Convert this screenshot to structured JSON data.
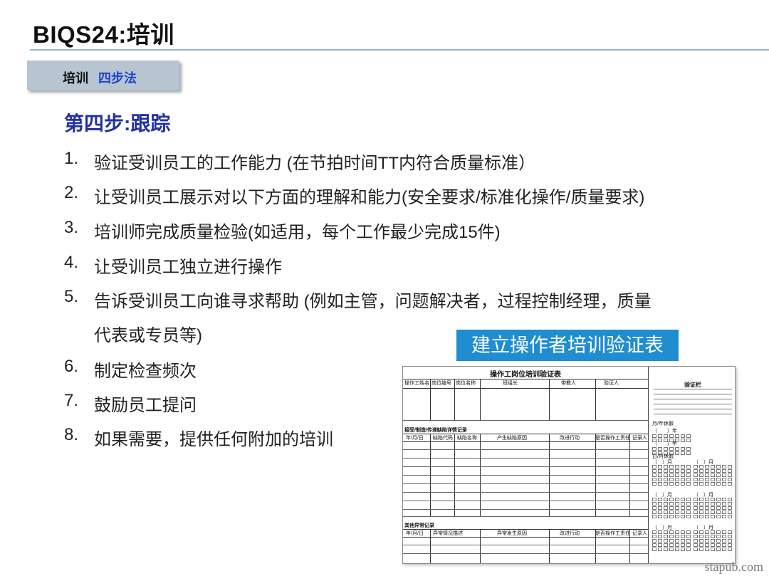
{
  "header": {
    "title": "BIQS24:培训"
  },
  "tab": {
    "part1": "培训",
    "part2": "四步法"
  },
  "step_title": "第四步:跟踪",
  "items": [
    {
      "num": "1.",
      "text": "验证受训员工的工作能力 (在节拍时间TT内符合质量标准）"
    },
    {
      "num": "2.",
      "text": "让受训员工展示对以下方面的理解和能力(安全要求/标准化操作/质量要求)"
    },
    {
      "num": "3.",
      "text": "培训师完成质量检验(如适用，每个工作最少完成15件)"
    },
    {
      "num": "4.",
      "text": "让受训员工独立进行操作"
    },
    {
      "num": "5.",
      "text": "告诉受训员工向谁寻求帮助 (例如主管，问题解决者，过程控制经理，质量",
      "text2": "代表或专员等)"
    },
    {
      "num": "6.",
      "text": "制定检查频次"
    },
    {
      "num": "7.",
      "text": "鼓励员工提问"
    },
    {
      "num": "8.",
      "text": "如果需要，提供任何附加的培训"
    }
  ],
  "banner": "建立操作者培训验证表",
  "form": {
    "title": "操作工岗位培训验证表",
    "headers": [
      "操作工姓名",
      "岗位编号",
      "岗位名称",
      "班组长",
      "带教人",
      "验证人"
    ],
    "section1": "接受/制造/传递缺陷详情记录",
    "section1_cols": [
      "年/月/日",
      "缺陷代码",
      "缺陷名称",
      "产生缺陷原因",
      "改进行动",
      "是否操作工责任",
      "记录人"
    ],
    "section2": "其他异常记录",
    "section2_cols": [
      "年/月/日",
      "异常情况描述",
      "异常发生原因",
      "改进行动",
      "是否操作工责任",
      "记录人"
    ],
    "verify_title": "验证栏",
    "verify_labels": [
      "月/年休假",
      "（　　）年",
      "（　　）年",
      "日/月休假",
      "（　）月",
      "（　）月",
      "（　）月",
      "（　）月",
      "（　）月",
      "（　）月"
    ]
  },
  "watermark": "stapub.com"
}
